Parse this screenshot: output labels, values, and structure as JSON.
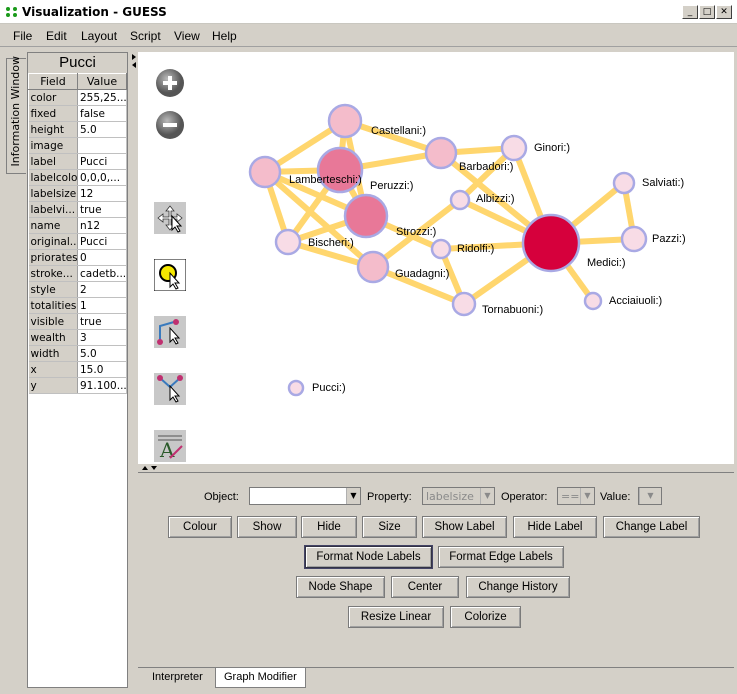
{
  "window": {
    "title": "Visualization - GUESS"
  },
  "menu": [
    "File",
    "Edit",
    "Layout",
    "Script",
    "View",
    "Help"
  ],
  "side_tab": "Information Window",
  "panel": {
    "title": "Pucci",
    "columns": [
      "Field",
      "Value"
    ],
    "rows": [
      [
        "color",
        "255,25..."
      ],
      [
        "fixed",
        "false"
      ],
      [
        "height",
        "5.0"
      ],
      [
        "image",
        ""
      ],
      [
        "label",
        "Pucci"
      ],
      [
        "labelcolor",
        "0,0,0,..."
      ],
      [
        "labelsize",
        "12"
      ],
      [
        "labelvi...",
        "true"
      ],
      [
        "name",
        "n12"
      ],
      [
        "original...",
        "Pucci"
      ],
      [
        "priorates",
        "0"
      ],
      [
        "stroke...",
        "cadetb..."
      ],
      [
        "style",
        "2"
      ],
      [
        "totalities",
        "1"
      ],
      [
        "visible",
        "true"
      ],
      [
        "wealth",
        "3"
      ],
      [
        "width",
        "5.0"
      ],
      [
        "x",
        "15.0"
      ],
      [
        "y",
        "91.100..."
      ]
    ]
  },
  "graph": {
    "colors": {
      "edge": "#ffd66e",
      "stroke": "#a9a9e4",
      "light": "#f8dce6",
      "pink": "#f4bccb",
      "mid": "#e87898",
      "dark": "#d6003c"
    },
    "nodes": [
      {
        "id": "castellani",
        "label": "Castellani:)",
        "fill": "pink"
      },
      {
        "id": "lamberteschi",
        "label": "Lamberteschi:)",
        "fill": "pink"
      },
      {
        "id": "peruzzi",
        "label": "Peruzzi:)",
        "fill": "mid"
      },
      {
        "id": "barbadori",
        "label": "Barbadori:)",
        "fill": "pink"
      },
      {
        "id": "ginori",
        "label": "Ginori:)",
        "fill": "light"
      },
      {
        "id": "albizzi",
        "label": "Albizzi:)",
        "fill": "light"
      },
      {
        "id": "salviati",
        "label": "Salviati:)",
        "fill": "light"
      },
      {
        "id": "strozzi",
        "label": "Strozzi:)",
        "fill": "mid"
      },
      {
        "id": "bischeri",
        "label": "Bischeri:)",
        "fill": "light"
      },
      {
        "id": "ridolfi",
        "label": "Ridolfi:)",
        "fill": "light"
      },
      {
        "id": "pazzi",
        "label": "Pazzi:)",
        "fill": "light"
      },
      {
        "id": "medici",
        "label": "Medici:)",
        "fill": "dark"
      },
      {
        "id": "guadagni",
        "label": "Guadagni:)",
        "fill": "pink"
      },
      {
        "id": "tornabuoni",
        "label": "Tornabuoni:)",
        "fill": "light"
      },
      {
        "id": "acciaiuoli",
        "label": "Acciaiuoli:)",
        "fill": "light"
      },
      {
        "id": "pucci",
        "label": "Pucci:)",
        "fill": "light"
      },
      {
        "id": "topnode",
        "label": "",
        "fill": "pink"
      }
    ]
  },
  "tools": [
    "zoom-in-icon",
    "zoom-out-icon",
    "move-tool-icon",
    "select-tool-icon",
    "edge-tool-icon",
    "node-tool-icon",
    "label-tool-icon"
  ],
  "modifier": {
    "object_label": "Object:",
    "object_value": "",
    "property_label": "Property:",
    "property_value": "labelsize",
    "operator_label": "Operator:",
    "operator_value": "==",
    "value_label": "Value:",
    "value_value": "",
    "buttons_row1": [
      "Colour",
      "Show",
      "Hide",
      "Size",
      "Show Label",
      "Hide Label",
      "Change Label"
    ],
    "buttons_row2": [
      "Format Node Labels",
      "Format Edge Labels"
    ],
    "buttons_row3": [
      "Node Shape",
      "Center",
      "Change History"
    ],
    "buttons_row4": [
      "Resize Linear",
      "Colorize"
    ]
  },
  "tabs": [
    "Interpreter",
    "Graph Modifier"
  ],
  "active_tab": "Graph Modifier"
}
